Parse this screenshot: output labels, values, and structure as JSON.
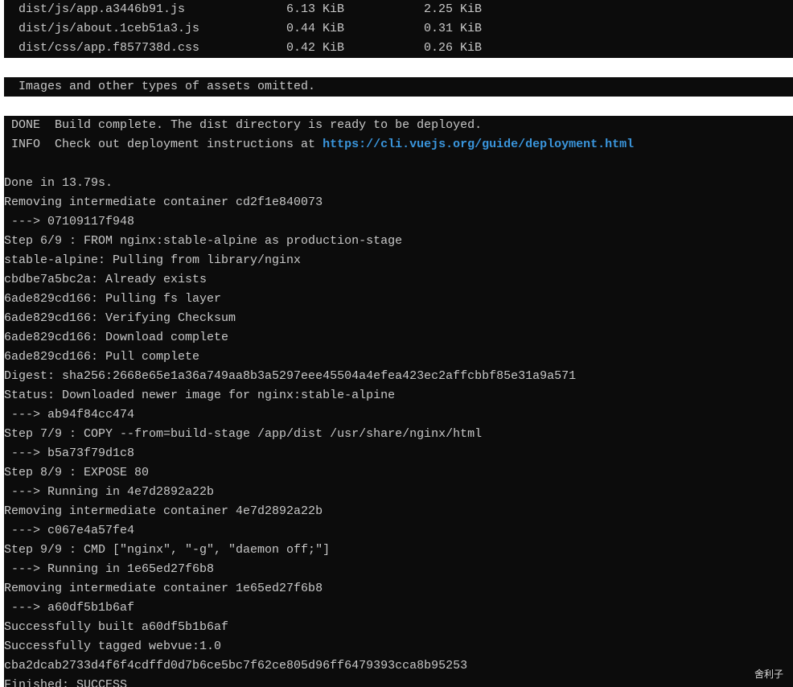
{
  "assets": [
    {
      "file": "dist/js/app.a3446b91.js",
      "size": "6.13 KiB",
      "gzipped": "2.25 KiB"
    },
    {
      "file": "dist/js/about.1ceb51a3.js",
      "size": "0.44 KiB",
      "gzipped": "0.31 KiB"
    },
    {
      "file": "dist/css/app.f857738d.css",
      "size": "0.42 KiB",
      "gzipped": "0.26 KiB"
    }
  ],
  "omitted_note": "  Images and other types of assets omitted.",
  "done_line": " DONE  Build complete. The dist directory is ready to be deployed.",
  "info_prefix": " INFO  Check out deployment instructions at ",
  "info_link": "https://cli.vuejs.org/guide/deployment.html",
  "colors": {
    "background": "#0c0c0c",
    "text": "#c8c8c8",
    "link": "#3a96dd"
  },
  "log_lines": [
    "",
    "Done in 13.79s.",
    "Removing intermediate container cd2f1e840073",
    " ---> 07109117f948",
    "Step 6/9 : FROM nginx:stable-alpine as production-stage",
    "stable-alpine: Pulling from library/nginx",
    "cbdbe7a5bc2a: Already exists",
    "6ade829cd166: Pulling fs layer",
    "6ade829cd166: Verifying Checksum",
    "6ade829cd166: Download complete",
    "6ade829cd166: Pull complete",
    "Digest: sha256:2668e65e1a36a749aa8b3a5297eee45504a4efea423ec2affcbbf85e31a9a571",
    "Status: Downloaded newer image for nginx:stable-alpine",
    " ---> ab94f84cc474",
    "Step 7/9 : COPY --from=build-stage /app/dist /usr/share/nginx/html",
    " ---> b5a73f79d1c8",
    "Step 8/9 : EXPOSE 80",
    " ---> Running in 4e7d2892a22b",
    "Removing intermediate container 4e7d2892a22b",
    " ---> c067e4a57fe4",
    "Step 9/9 : CMD [\"nginx\", \"-g\", \"daemon off;\"]",
    " ---> Running in 1e65ed27f6b8",
    "Removing intermediate container 1e65ed27f6b8",
    " ---> a60df5b1b6af",
    "Successfully built a60df5b1b6af",
    "Successfully tagged webvue:1.0",
    "cba2dcab2733d4f6f4cdffd0d7b6ce5bc7f62ce805d96ff6479393cca8b95253",
    "Finished: SUCCESS"
  ],
  "watermark": "舍利子"
}
